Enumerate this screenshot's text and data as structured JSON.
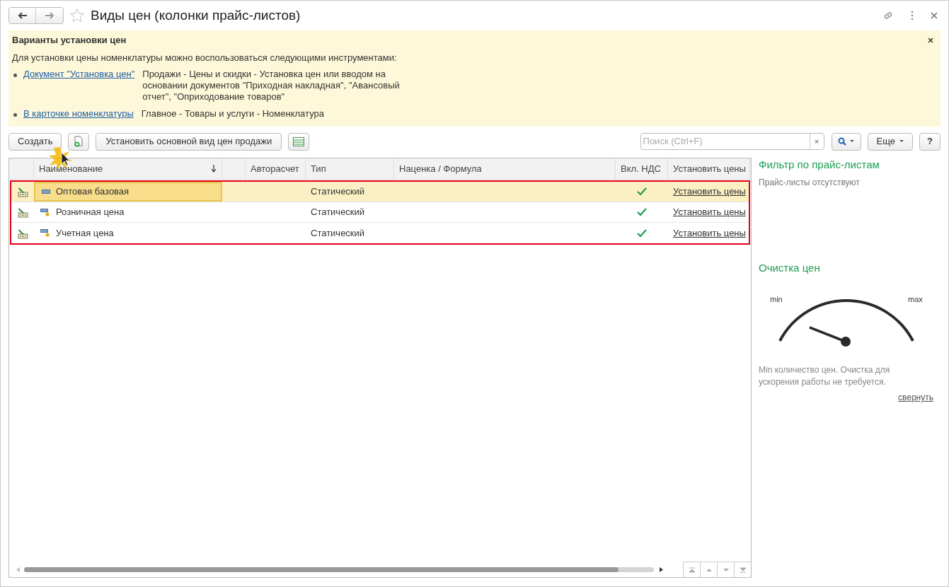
{
  "window": {
    "title": "Виды цен (колонки прайс-листов)",
    "favorite": false
  },
  "info_panel": {
    "title": "Варианты установки цен",
    "intro": "Для установки цены номенклатуры можно воспользоваться следующими инструментами:",
    "items": [
      {
        "link": "Документ \"Установка цен\"",
        "text": "Продажи - Цены и скидки - Установка цен или вводом на основании документов \"Приходная накладная\", \"Авансовый отчет\", \"Оприходование товаров\""
      },
      {
        "link": "В карточке номенклатуры",
        "text": "Главное - Товары и услуги - Номенклатура"
      }
    ]
  },
  "toolbar": {
    "create": "Создать",
    "set_main": "Установить основной вид цен продажи",
    "search": {
      "placeholder": "Поиск (Ctrl+F)"
    },
    "clear": "×",
    "more": "Еще",
    "help": "?"
  },
  "table": {
    "columns": [
      {
        "label": "Наименование",
        "sorted": true
      },
      {},
      {
        "label": "Авторасчет"
      },
      {
        "label": "Тип"
      },
      {
        "label": "Наценка / Формула"
      },
      {
        "label": "Вкл. НДС"
      },
      {
        "label": "Установить цены"
      }
    ],
    "rows": [
      {
        "name": "Оптовая базовая",
        "kind": "base",
        "type": "Статический",
        "vat": true,
        "action": "Установить цены",
        "selected": true
      },
      {
        "name": "Розничная цена",
        "kind": "derived",
        "type": "Статический",
        "vat": true,
        "action": "Установить цены",
        "selected": false
      },
      {
        "name": "Учетная цена",
        "kind": "derived",
        "type": "Статический",
        "vat": true,
        "action": "Установить цены",
        "selected": false
      }
    ]
  },
  "filter_panel": {
    "title": "Фильтр по прайс-листам",
    "note": "Прайс-листы отсутствуют"
  },
  "cleanup_panel": {
    "title": "Очистка цен",
    "min_label": "min",
    "max_label": "max",
    "note": "Min количество цен. Очистка для ускорения работы не требуется.",
    "collapse": "свернуть"
  }
}
